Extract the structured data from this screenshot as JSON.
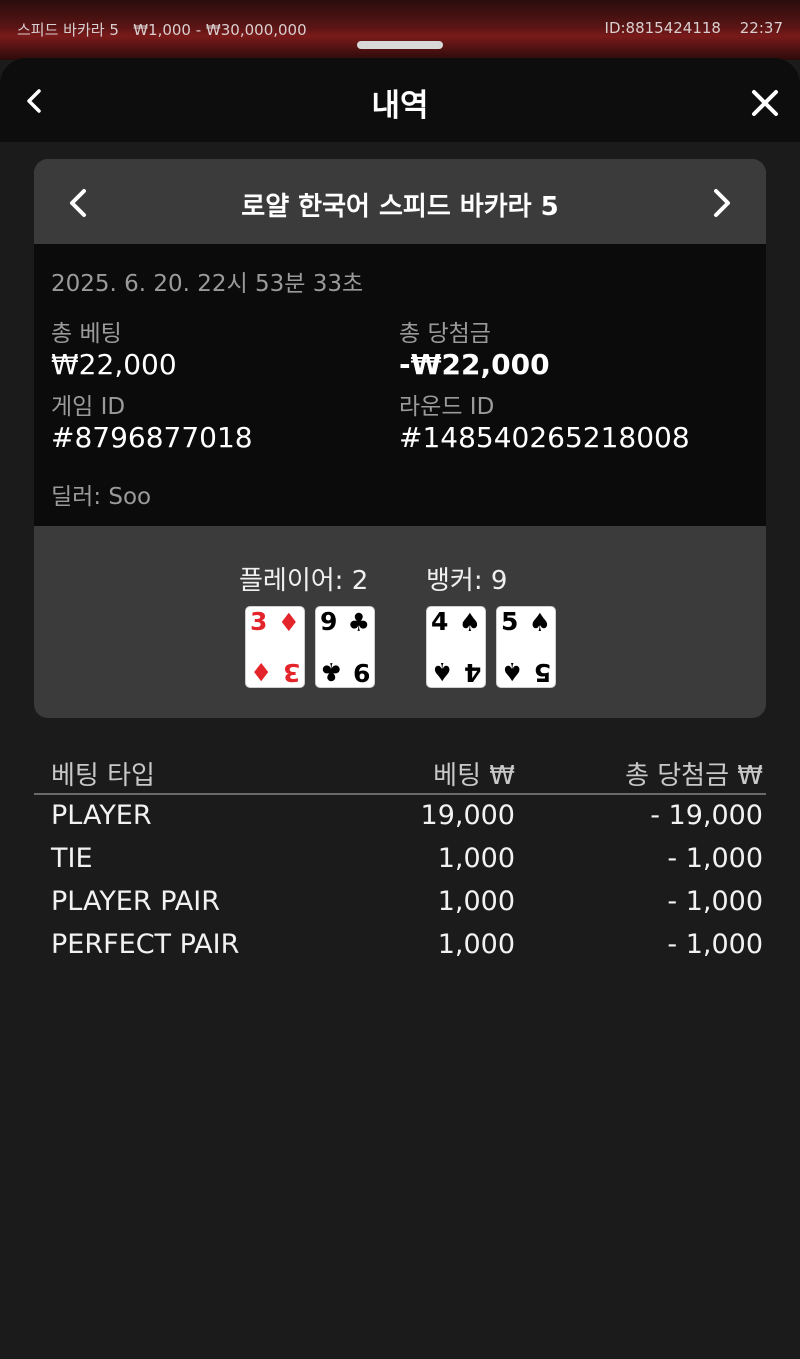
{
  "status_bar": {
    "table_name": "스피드 바카라 5",
    "limits": "₩1,000 - ₩30,000,000",
    "player_id": "ID:8815424118",
    "time": "22:37"
  },
  "header": {
    "title": "내역"
  },
  "game": {
    "name": "로얄 한국어 스피드 바카라 5",
    "datetime": "2025. 6. 20. 22시 53분 33초",
    "total_bet_label": "총 베팅",
    "total_bet_value": "₩22,000",
    "total_win_label": "총 당첨금",
    "total_win_value": "-₩22,000",
    "game_id_label": "게임 ID",
    "game_id_value": "#8796877018",
    "round_id_label": "라운드 ID",
    "round_id_value": "#148540265218008",
    "dealer": "딜러: Soo"
  },
  "hands": {
    "player_label": "플레이어: 2",
    "banker_label": "뱅커: 9",
    "player_cards": [
      {
        "rank": "3",
        "suit": "♦",
        "color": "#e3252b"
      },
      {
        "rank": "9",
        "suit": "♣",
        "color": "#000000"
      }
    ],
    "banker_cards": [
      {
        "rank": "4",
        "suit": "♠",
        "color": "#000000"
      },
      {
        "rank": "5",
        "suit": "♠",
        "color": "#000000"
      }
    ]
  },
  "bets_table": {
    "columns": [
      "베팅 타입",
      "베팅 ₩",
      "총 당첨금 ₩"
    ],
    "rows": [
      {
        "type": "PLAYER",
        "bet": "19,000",
        "win": "- 19,000"
      },
      {
        "type": "TIE",
        "bet": "1,000",
        "win": "- 1,000"
      },
      {
        "type": "PLAYER PAIR",
        "bet": "1,000",
        "win": "- 1,000"
      },
      {
        "type": "PERFECT PAIR",
        "bet": "1,000",
        "win": "- 1,000"
      }
    ]
  }
}
